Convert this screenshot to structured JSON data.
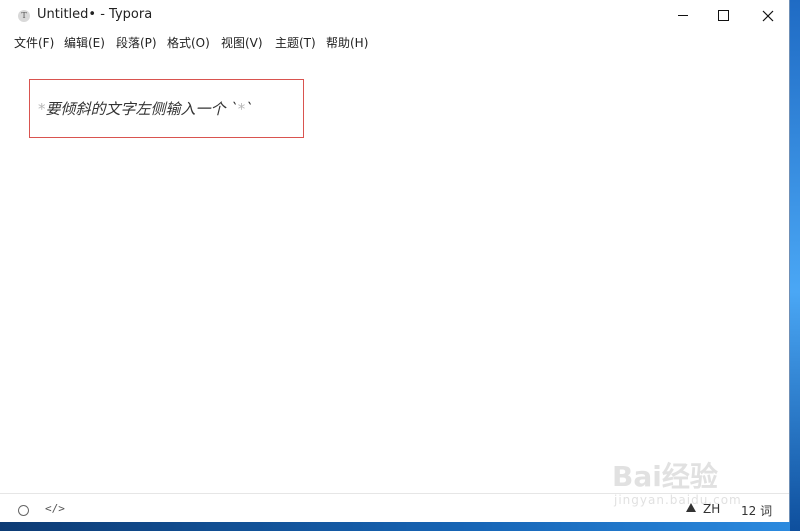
{
  "window": {
    "title": "Untitled• - Typora",
    "app_icon_letter": "T"
  },
  "menu": {
    "items": [
      "文件(F)",
      "编辑(E)",
      "段落(P)",
      "格式(O)",
      "视图(V)",
      "主题(T)",
      "帮助(H)"
    ]
  },
  "editor": {
    "open_marker": "*",
    "italic_text": "要倾斜的文字左侧输入一个 `",
    "inline_marker": "*",
    "tail": "`"
  },
  "status": {
    "lang": "ZH",
    "word_count": "12 词",
    "code_toggle": "</>"
  },
  "watermark": {
    "logo": "Bai经验",
    "url": "jingyan.baidu.com"
  },
  "colors": {
    "highlight_border": "#d9534f",
    "marker": "#b8b8b8"
  }
}
